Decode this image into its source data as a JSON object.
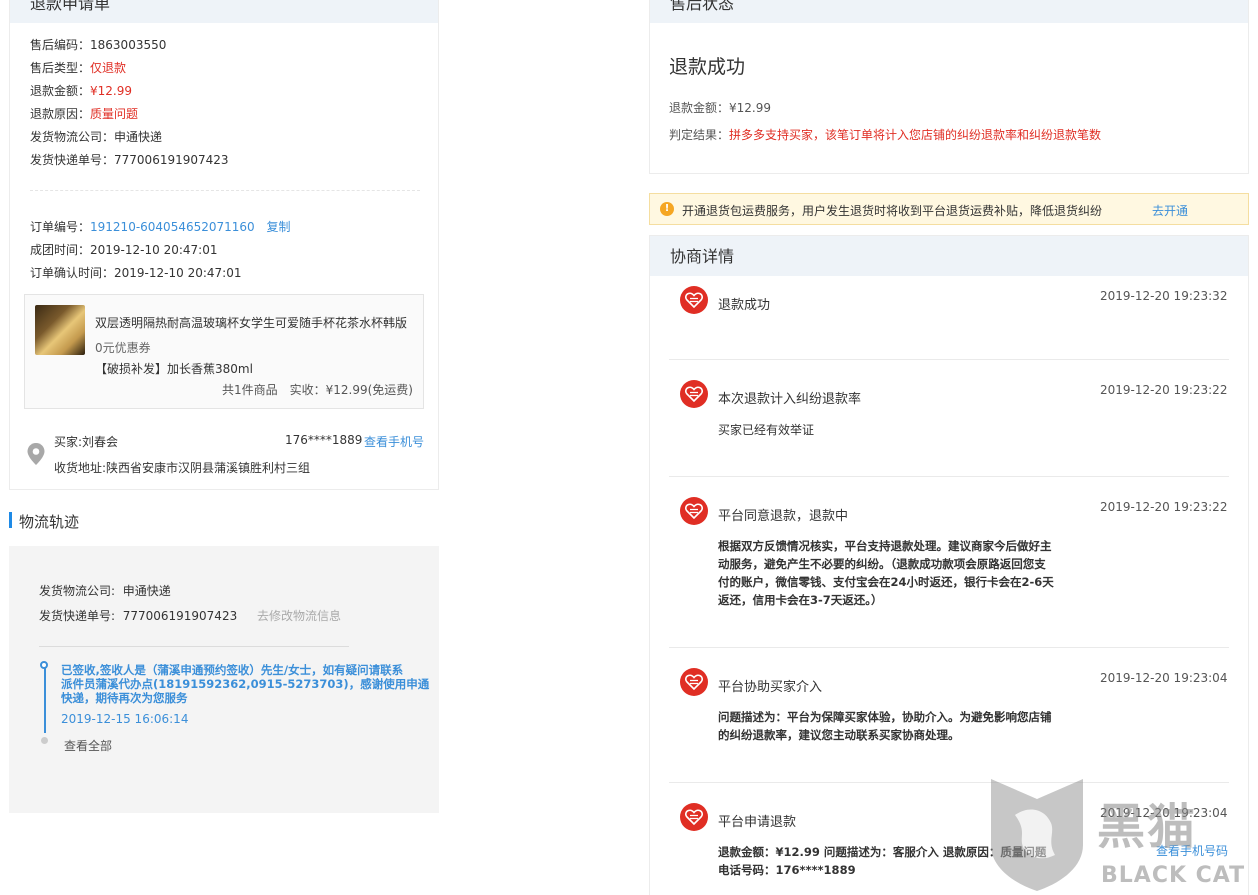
{
  "refund_form": {
    "title": "退款申请单",
    "aftersale_code_label": "售后编码：",
    "aftersale_code": "1863003550",
    "aftersale_type_label": "售后类型：",
    "aftersale_type": "仅退款",
    "refund_amount_label": "退款金额：",
    "refund_amount": "¥12.99",
    "refund_reason_label": "退款原因：",
    "refund_reason": "质量问题",
    "courier_label": "发货物流公司：",
    "courier": "申通快递",
    "tracking_label": "发货快递单号：",
    "tracking": "777006191907423",
    "order_no_label": "订单编号：",
    "order_no": "191210-604054652071160",
    "copy_label": "复制",
    "group_time_label": "成团时间：",
    "group_time": "2019-12-10 20:47:01",
    "confirm_time_label": "订单确认时间：",
    "confirm_time": "2019-12-10 20:47:01",
    "product": {
      "name": "双层透明隔热耐高温玻璃杯女学生可爱随手杯花茶水杯韩版",
      "coupon": "0元优惠券",
      "spec": "【破损补发】加长香蕉380ml",
      "summary": "共1件商品　实收：¥12.99(免运费)"
    },
    "buyer_label": "买家:",
    "buyer": "刘春会",
    "phone": "176****1889",
    "view_phone": "查看手机号",
    "address": "收货地址:陕西省安康市汉阴县蒲溪镇胜利村三组"
  },
  "logistics": {
    "title": "物流轨迹",
    "courier_label": "发货物流公司:",
    "courier": "申通快递",
    "tracking_label": "发货快递单号:",
    "tracking": "777006191907423",
    "modify_link": "去修改物流信息",
    "event_line1": "已签收,签收人是（蒲溪申通预约签收）先生/女士，如有疑问请联系",
    "event_line2": "派件员蒲溪代办点(18191592362,0915-5273703)，感谢使用申通",
    "event_line3": "快递，期待再次为您服务",
    "event_time": "2019-12-15 16:06:14",
    "view_all": "查看全部"
  },
  "aftersale_status": {
    "title": "售后状态",
    "status": "退款成功",
    "amount_label": "退款金额：",
    "amount": "¥12.99",
    "verdict_label": "判定结果：",
    "verdict": "拼多多支持买家，该笔订单将计入您店铺的纠纷退款率和纠纷退款笔数"
  },
  "notice": {
    "icon": "!",
    "text": "开通退货包运费服务，用户发生退货时将收到平台退货运费补贴，降低退货纠纷",
    "link": "去开通"
  },
  "negotiation": {
    "title": "协商详情",
    "items": [
      {
        "title": "退款成功",
        "time": "2019-12-20 19:23:32"
      },
      {
        "title": "本次退款计入纠纷退款率",
        "time": "2019-12-20 19:23:22",
        "line1": "买家已经有效举证"
      },
      {
        "title": "平台同意退款，退款中",
        "time": "2019-12-20 19:23:22",
        "line1": "根据双方反馈情况核实，平台支持退款处理。建议商家今后做好主",
        "line2": "动服务，避免产生不必要的纠纷。（退款成功款项会原路返回您支",
        "line3": "付的账户，微信零钱、支付宝会在24小时返还，银行卡会在2-6天",
        "line4": "返还，信用卡会在3-7天返还。）"
      },
      {
        "title": "平台协助买家介入",
        "time": "2019-12-20 19:23:04",
        "line1": "问题描述为：平台为保障买家体验，协助介入。为避免影响您店铺",
        "line2": "的纠纷退款率，建议您主动联系买家协商处理。"
      },
      {
        "title": "平台申请退款",
        "time": "2019-12-20 19:23:04",
        "line1": "退款金额：¥12.99 问题描述为：客服介入 退款原因：质量问题",
        "line2": "电话号码：176****1889",
        "link": "查看手机号码"
      }
    ]
  },
  "watermark": {
    "cn": "黑猫",
    "en": "BLACK CAT"
  }
}
